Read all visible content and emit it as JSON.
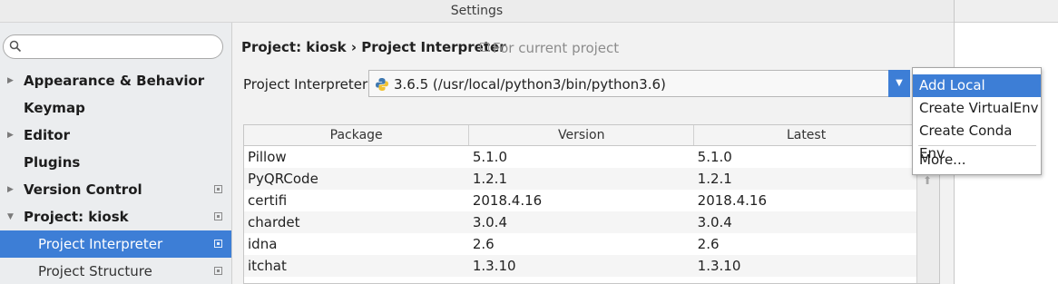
{
  "window": {
    "title": "Settings"
  },
  "sidebar": {
    "search_placeholder": "",
    "items": [
      {
        "label": "Appearance & Behavior",
        "expandable": true
      },
      {
        "label": "Keymap"
      },
      {
        "label": "Editor",
        "expandable": true
      },
      {
        "label": "Plugins"
      },
      {
        "label": "Version Control",
        "expandable": true,
        "project_icon": true
      },
      {
        "label": "Project: kiosk",
        "expanded": true,
        "project_icon": true
      },
      {
        "label": "Project Interpreter",
        "selected": true,
        "project_icon": true
      },
      {
        "label": "Project Structure",
        "project_icon": true
      }
    ]
  },
  "main": {
    "breadcrumb": "Project: kiosk › Project Interpreter",
    "scope_note": "For current project",
    "interpreter_label": "Project Interpreter:",
    "interpreter_value": "3.6.5 (/usr/local/python3/bin/python3.6)"
  },
  "packages": {
    "columns": [
      "Package",
      "Version",
      "Latest"
    ],
    "rows": [
      [
        "Pillow",
        "5.1.0",
        "5.1.0"
      ],
      [
        "PyQRCode",
        "1.2.1",
        "1.2.1"
      ],
      [
        "certifi",
        "2018.4.16",
        "2018.4.16"
      ],
      [
        "chardet",
        "3.0.4",
        "3.0.4"
      ],
      [
        "idna",
        "2.6",
        "2.6"
      ],
      [
        "itchat",
        "1.3.10",
        "1.3.10"
      ]
    ]
  },
  "menu": {
    "items": [
      "Add Local",
      "Create VirtualEnv",
      "Create Conda Env",
      "More..."
    ],
    "highlighted_index": 0
  },
  "colors": {
    "accent": "#3d7ed6"
  }
}
